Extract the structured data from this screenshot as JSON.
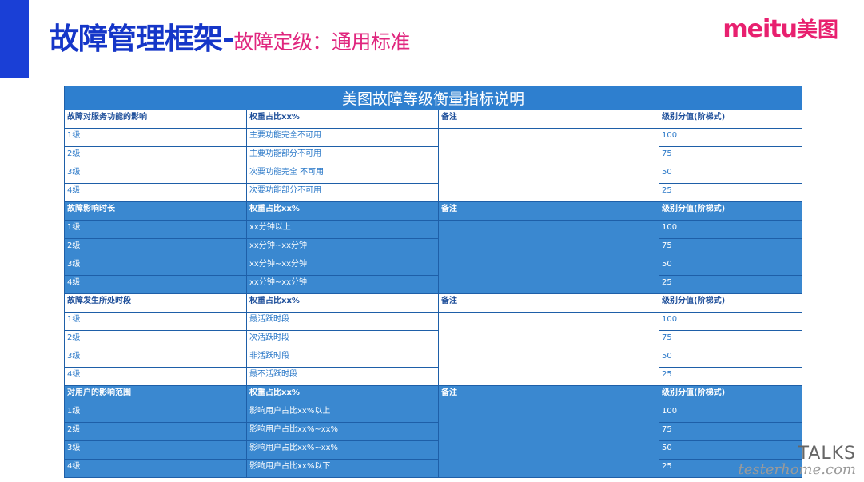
{
  "header": {
    "title_main": "故障管理框架-",
    "title_sub": "故障定级：通用标准",
    "logo_latin": "meitu",
    "logo_cjk": "美图"
  },
  "table": {
    "title": "美图故障等级衡量指标说明",
    "sections": [
      {
        "style": "white",
        "header": [
          "故障对服务功能的影响",
          "权重占比xx%",
          "备注",
          "级别分值(阶梯式)"
        ],
        "rows": [
          [
            "1级",
            "主要功能完全不可用",
            "100"
          ],
          [
            "2级",
            "主要功能部分不可用",
            "75"
          ],
          [
            "3级",
            "次要功能完全 不可用",
            "50"
          ],
          [
            "4级",
            "次要功能部分不可用",
            "25"
          ]
        ]
      },
      {
        "style": "blue",
        "header": [
          "故障影响时长",
          "权重占比xx%",
          "备注",
          "级别分值(阶梯式)"
        ],
        "rows": [
          [
            "1级",
            "xx分钟以上",
            "100"
          ],
          [
            "2级",
            "xx分钟~xx分钟",
            "75"
          ],
          [
            "3级",
            "xx分钟~xx分钟",
            "50"
          ],
          [
            "4级",
            "xx分钟~xx分钟",
            "25"
          ]
        ]
      },
      {
        "style": "white",
        "header": [
          "故障发生所处时段",
          "权重占比xx%",
          "备注",
          "级别分值(阶梯式)"
        ],
        "rows": [
          [
            "1级",
            "最活跃时段",
            "100"
          ],
          [
            "2级",
            "次活跃时段",
            "75"
          ],
          [
            "3级",
            "非活跃时段",
            "50"
          ],
          [
            "4级",
            "最不活跃时段",
            "25"
          ]
        ]
      },
      {
        "style": "blue",
        "header": [
          "对用户的影响范围",
          "权重占比xx%",
          "备注",
          "级别分值(阶梯式)"
        ],
        "rows": [
          [
            "1级",
            "影响用户占比xx%以上",
            "100"
          ],
          [
            "2级",
            "影响用户占比xx%~xx%",
            "75"
          ],
          [
            "3级",
            "影响用户占比xx%~xx%",
            "50"
          ],
          [
            "4级",
            "影响用户占比xx%以下",
            "25"
          ]
        ]
      }
    ]
  },
  "watermark": {
    "brand": "TALKS",
    "site": "testerhome.com"
  }
}
